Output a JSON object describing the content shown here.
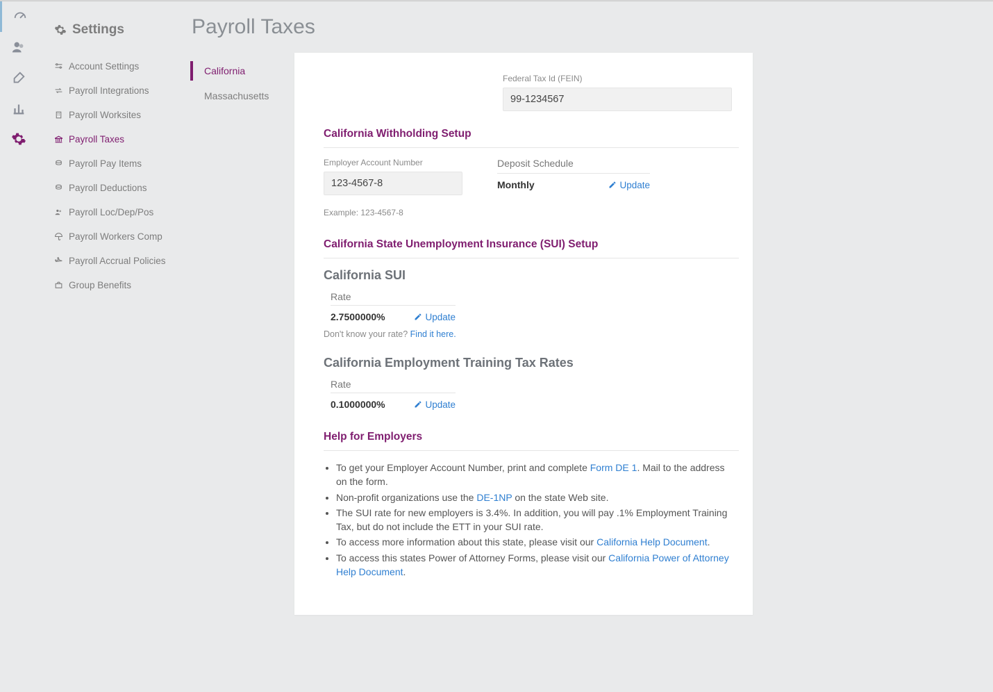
{
  "rail": {
    "items": [
      "dashboard",
      "people",
      "appearance",
      "reports",
      "settings"
    ]
  },
  "sidebar": {
    "title": "Settings",
    "links": [
      {
        "label": "Account Settings"
      },
      {
        "label": "Payroll Integrations"
      },
      {
        "label": "Payroll Worksites"
      },
      {
        "label": "Payroll Taxes",
        "active": true
      },
      {
        "label": "Payroll Pay Items"
      },
      {
        "label": "Payroll Deductions"
      },
      {
        "label": "Payroll Loc/Dep/Pos"
      },
      {
        "label": "Payroll Workers Comp"
      },
      {
        "label": "Payroll Accrual Policies"
      },
      {
        "label": "Group Benefits"
      }
    ]
  },
  "page": {
    "title": "Payroll Taxes"
  },
  "tabs": [
    {
      "label": "California",
      "active": true
    },
    {
      "label": "Massachusetts"
    }
  ],
  "fein": {
    "label": "Federal Tax Id (FEIN)",
    "value": "99-1234567"
  },
  "withholding": {
    "title": "California Withholding Setup",
    "ean_label": "Employer Account Number",
    "ean_value": "123-4567-8",
    "example": "Example: 123-4567-8",
    "deposit_label": "Deposit Schedule",
    "deposit_value": "Monthly",
    "update": "Update"
  },
  "sui": {
    "title": "California State Unemployment Insurance (SUI) Setup",
    "heading": "California SUI",
    "rate_label": "Rate",
    "rate_value": "2.7500000%",
    "update": "Update",
    "help_prefix": "Don't know your rate? ",
    "help_link": "Find it here."
  },
  "ett": {
    "heading": "California Employment Training Tax Rates",
    "rate_label": "Rate",
    "rate_value": "0.1000000%",
    "update": "Update"
  },
  "help": {
    "title": "Help for Employers",
    "li1a": "To get your Employer Account Number, print and complete ",
    "li1link": "Form DE 1",
    "li1b": ". Mail to the address on the form.",
    "li2a": "Non-profit organizations use the ",
    "li2link": "DE-1NP",
    "li2b": " on the state Web site.",
    "li3": "The SUI rate for new employers is 3.4%. In addition, you will pay .1% Employment Training Tax, but do not include the ETT in your SUI rate.",
    "li4a": "To access more information about this state, please visit our ",
    "li4link": "California Help Document",
    "li4b": ".",
    "li5a": "To access this states Power of Attorney Forms, please visit our ",
    "li5link": "California Power of Attorney Help Document",
    "li5b": "."
  }
}
